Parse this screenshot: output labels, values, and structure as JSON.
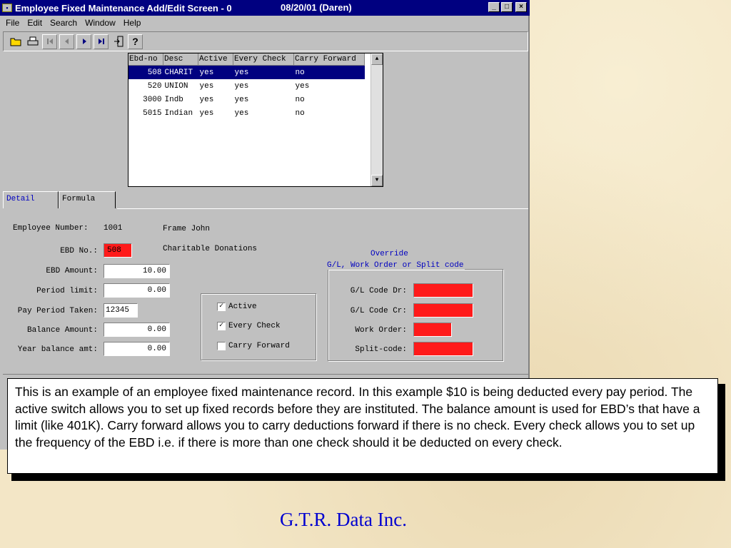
{
  "window": {
    "title": "Employee Fixed Maintenance Add/Edit Screen - 0",
    "date_user": "08/20/01 (Daren)",
    "min_glyph": "_",
    "max_glyph": "□",
    "close_glyph": "×"
  },
  "menu": [
    "File",
    "Edit",
    "Search",
    "Window",
    "Help"
  ],
  "toolbar": {
    "icons": [
      "open-folder-icon",
      "print-icon",
      "first-record-icon",
      "previous-record-icon",
      "next-record-icon",
      "last-record-icon",
      "exit-icon",
      "help-icon"
    ],
    "help_glyph": "?"
  },
  "grid": {
    "headers": [
      "Ebd-no",
      "Desc",
      "Active",
      "Every Check",
      "Carry Forward"
    ],
    "rows": [
      [
        "508",
        "CHARIT",
        "yes",
        "yes",
        "no"
      ],
      [
        "520",
        "UNION",
        "yes",
        "yes",
        "yes"
      ],
      [
        "3000",
        "Indb",
        "yes",
        "yes",
        "no"
      ],
      [
        "5015",
        "Indian",
        "yes",
        "yes",
        "no"
      ]
    ],
    "selected_row": 0
  },
  "tabs": [
    "Detail",
    "Formula"
  ],
  "detail": {
    "employee_number_label": "Employee Number:",
    "employee_number": "1001",
    "employee_name": "Frame John",
    "ebd_no_label": "EBD No.:",
    "ebd_no": "508",
    "ebd_desc": "Charitable Donations",
    "ebd_amount_label": "EBD Amount:",
    "ebd_amount": "10.00",
    "period_limit_label": "Period limit:",
    "period_limit": "0.00",
    "pay_period_taken_label": "Pay Period Taken:",
    "pay_period_taken": "12345",
    "balance_amount_label": "Balance Amount:",
    "balance_amount": "0.00",
    "year_balance_label": "Year balance amt:",
    "year_balance": "0.00"
  },
  "flags": {
    "active_label": "Active",
    "active": true,
    "every_check_label": "Every Check",
    "every_check": true,
    "carry_forward_label": "Carry Forward",
    "carry_forward": false
  },
  "override": {
    "title_line1": "Override",
    "title_line2": "G/L,  Work Order or Split code",
    "gl_dr_label": "G/L Code Dr:",
    "gl_cr_label": "G/L Code Cr:",
    "work_order_label": "Work Order:",
    "split_code_label": "Split-code:"
  },
  "note": "This is an example of  an employee fixed maintenance record.  In this example $10 is being deducted every pay period.  The active switch allows you to set up fixed records before they are instituted.  The balance amount is used for EBD’s that have a limit (like 401K).  Carry forward allows you to carry deductions forward if there is no check.  Every check allows you to set up the frequency of the EBD i.e. if there is more than one check should it be deducted on every check.",
  "footer": "G.T.R. Data Inc.",
  "colors": {
    "title_bar": "#000080",
    "required_field": "#ff1a1a",
    "tab_active_text": "#0000c0",
    "footer_text": "#0000d0",
    "slide_background": "#f3e6c6"
  }
}
